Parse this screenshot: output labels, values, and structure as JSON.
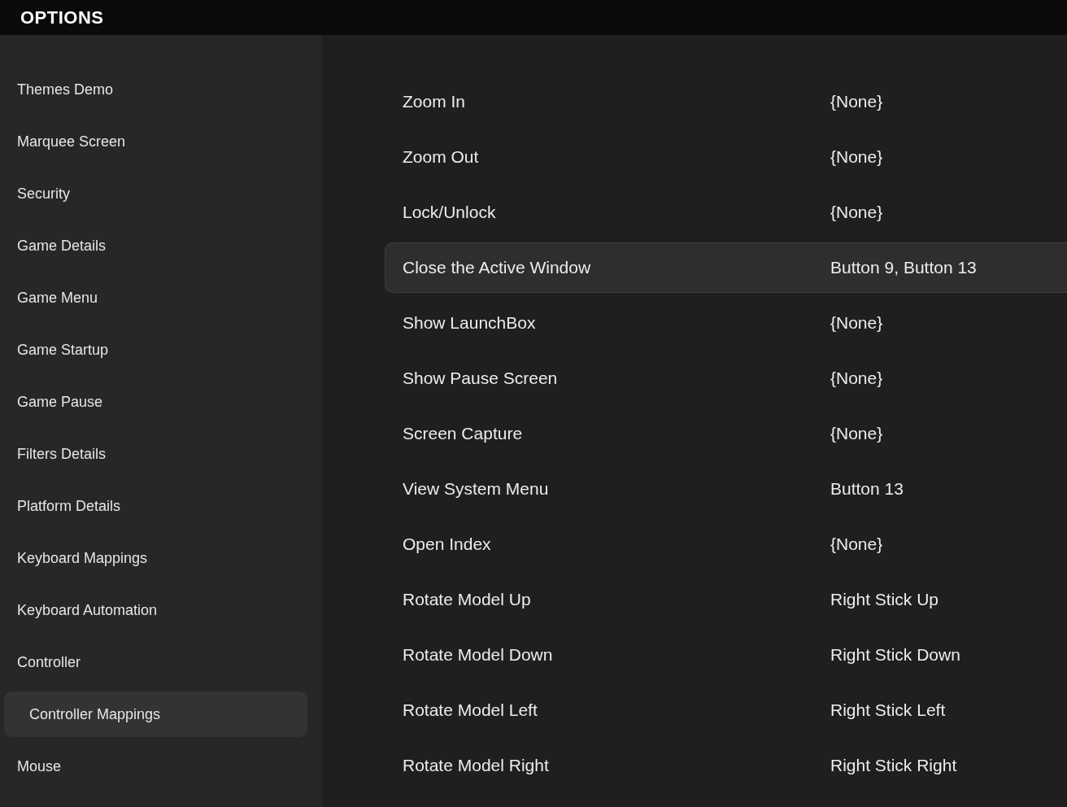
{
  "window": {
    "title": "OPTIONS"
  },
  "sidebar": {
    "items": [
      {
        "label": "Themes Demo",
        "selected": false
      },
      {
        "label": "Marquee Screen",
        "selected": false
      },
      {
        "label": "Security",
        "selected": false
      },
      {
        "label": "Game Details",
        "selected": false
      },
      {
        "label": "Game Menu",
        "selected": false
      },
      {
        "label": "Game Startup",
        "selected": false
      },
      {
        "label": "Game Pause",
        "selected": false
      },
      {
        "label": "Filters Details",
        "selected": false
      },
      {
        "label": "Platform Details",
        "selected": false
      },
      {
        "label": "Keyboard Mappings",
        "selected": false
      },
      {
        "label": "Keyboard Automation",
        "selected": false
      },
      {
        "label": "Controller",
        "selected": false
      },
      {
        "label": "Controller Mappings",
        "selected": true
      },
      {
        "label": "Mouse",
        "selected": false
      }
    ]
  },
  "mappings": [
    {
      "action": "Zoom In",
      "binding": "{None}",
      "selected": false
    },
    {
      "action": "Zoom Out",
      "binding": "{None}",
      "selected": false
    },
    {
      "action": "Lock/Unlock",
      "binding": "{None}",
      "selected": false
    },
    {
      "action": "Close the Active Window",
      "binding": "Button 9, Button 13",
      "selected": true
    },
    {
      "action": "Show LaunchBox",
      "binding": "{None}",
      "selected": false
    },
    {
      "action": "Show Pause Screen",
      "binding": "{None}",
      "selected": false
    },
    {
      "action": "Screen Capture",
      "binding": "{None}",
      "selected": false
    },
    {
      "action": "View System Menu",
      "binding": "Button 13",
      "selected": false
    },
    {
      "action": "Open Index",
      "binding": "{None}",
      "selected": false
    },
    {
      "action": "Rotate Model Up",
      "binding": "Right Stick Up",
      "selected": false
    },
    {
      "action": "Rotate Model Down",
      "binding": "Right Stick Down",
      "selected": false
    },
    {
      "action": "Rotate Model Left",
      "binding": "Right Stick Left",
      "selected": false
    },
    {
      "action": "Rotate Model Right",
      "binding": "Right Stick Right",
      "selected": false
    }
  ]
}
